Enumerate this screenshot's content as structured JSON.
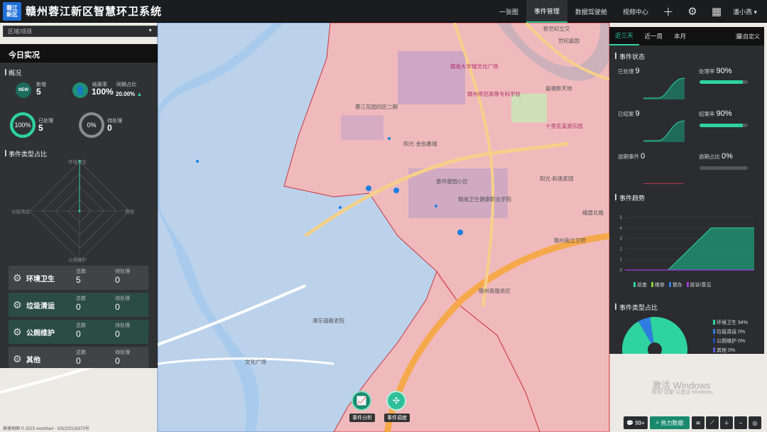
{
  "header": {
    "logo_line1": "蓉江",
    "logo_line2": "新区",
    "title": "赣州蓉江新区智慧环卫系统",
    "tabs": [
      "一张图",
      "事件管理",
      "数据驾驶舱",
      "视频中心"
    ],
    "active_tab": "事件管理",
    "user": "潘小燕"
  },
  "region_select": {
    "value": "区域/项目"
  },
  "left_panel": {
    "title": "今日实况",
    "overview_title": "概况",
    "new_label": "新增",
    "new_value": "5",
    "new_badge": "NEW",
    "close_rate_label": "结案率",
    "close_rate_value": "100%",
    "yoy_label": "同期占比",
    "yoy_value": "20.00%",
    "ring1_value": "100%",
    "ring1_label": "已处理",
    "ring1_count": "5",
    "ring2_value": "0%",
    "ring2_label": "待处理",
    "ring2_count": "0",
    "type_title": "事件类型占比",
    "radar_axes": [
      "环境卫生",
      "其他",
      "公厕维护",
      "垃圾清运"
    ],
    "categories": [
      {
        "name": "环境卫生",
        "total_label": "总数",
        "total": "5",
        "pending_label": "待处理",
        "pending": "0"
      },
      {
        "name": "垃圾清运",
        "total_label": "总数",
        "total": "0",
        "pending_label": "待处理",
        "pending": "0"
      },
      {
        "name": "公厕维护",
        "total_label": "总数",
        "total": "0",
        "pending_label": "待处理",
        "pending": "0"
      },
      {
        "name": "其他",
        "total_label": "总数",
        "total": "0",
        "pending_label": "待处理",
        "pending": "0"
      }
    ]
  },
  "right_panel": {
    "tabs": [
      "近三天",
      "近一周",
      "本月"
    ],
    "active_tab": "近三天",
    "custom": "自定义",
    "status_title": "事件状态",
    "processed_label": "已处理",
    "processed_value": "9",
    "process_rate_label": "处理率",
    "process_rate_value": "90%",
    "process_rate_fraction": 0.9,
    "closed_label": "已结案",
    "closed_value": "9",
    "close_rate_label": "结案率",
    "close_rate_value": "90%",
    "close_rate_fraction": 0.9,
    "overdue_label": "逾期事件",
    "overdue_value": "0",
    "overdue_rate_label": "逾期占比",
    "overdue_rate_value": "0%",
    "overdue_rate_fraction": 0,
    "trend_title": "事件趋势",
    "trend_legend": [
      "巡查",
      "维修",
      "督办",
      "投诉/意见"
    ],
    "type_title": "事件类型占比",
    "type_legend": [
      "环境卫生 94%",
      "垃圾清运 0%",
      "公厕维护 0%",
      "其他 0%"
    ]
  },
  "chart_data": [
    {
      "type": "area",
      "title": "事件趋势",
      "ylim": [
        0,
        5
      ],
      "y_ticks": [
        0,
        1,
        2,
        3,
        4,
        5
      ],
      "series": [
        {
          "name": "巡查",
          "values": [
            0,
            0,
            4,
            4
          ]
        }
      ],
      "legend": [
        "巡查",
        "维修",
        "督办",
        "投诉/意见"
      ]
    },
    {
      "type": "pie",
      "title": "事件类型占比",
      "labels": [
        "环境卫生",
        "垃圾清运",
        "公厕维护",
        "其他"
      ],
      "values": [
        94,
        0,
        0,
        0
      ]
    }
  ],
  "bottom": {
    "analysis_label": "事件分析",
    "dispatch_label": "事件调度",
    "msg_count": "99+",
    "heat_label": "热力数据",
    "watermark1": "激活 Windows",
    "watermark2": "转到\"设置\"以激活 Windows。",
    "copyright": "高德地图 © 2023 AutoNavi - GS(2021)6375号"
  },
  "map_labels": {
    "poi1": "赣南大学城文化广场",
    "poi2": "赣州师范高等专科学校",
    "poi3": "蓉江花园四区二期",
    "poi4": "阳光·金色春城",
    "poi5": "泰坪康园小区",
    "poi6": "赣南卫生健康职业学院",
    "poi7": "阳光·和逸家园",
    "poi8": "十里花溪游乐园",
    "poi9": "世纪嘉园",
    "poi10": "嘉福新天地",
    "poi11": "赣州南服务区",
    "poi12": "潭东镇敬老院",
    "poi13": "文化广场",
    "poi14": "赣州南立交桥",
    "poi15": "新世纪立交",
    "poi16": "峨眉北路"
  }
}
